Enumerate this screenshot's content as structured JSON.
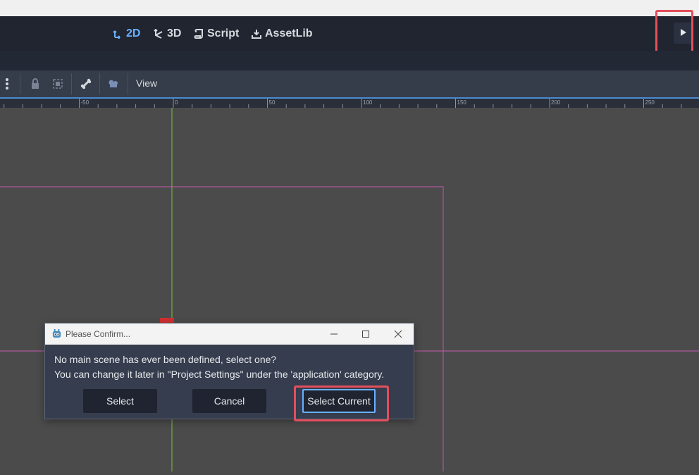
{
  "workspace_tabs": [
    {
      "label": "2D",
      "icon": "2d-icon",
      "active": true
    },
    {
      "label": "3D",
      "icon": "3d-icon",
      "active": false
    },
    {
      "label": "Script",
      "icon": "script-icon",
      "active": false
    },
    {
      "label": "AssetLib",
      "icon": "assetlib-icon",
      "active": false
    }
  ],
  "toolbar": {
    "view_label": "View"
  },
  "ruler": {
    "labels": [
      "-50",
      "0",
      "50",
      "100",
      "150",
      "200",
      "250"
    ]
  },
  "dialog": {
    "title": "Please Confirm...",
    "message_line1": "No main scene has ever been defined, select one?",
    "message_line2": "You can change it later in \"Project Settings\" under the 'application' category.",
    "buttons": {
      "select": "Select",
      "cancel": "Cancel",
      "select_current": "Select Current"
    }
  },
  "colors": {
    "accent": "#6ab0ff",
    "highlight": "#e34f5c",
    "viewport_bg": "#4b4b4b",
    "scene_rect": "#c45ab0",
    "y_axis": "#7fbf3f",
    "x_axis": "#c45ab0"
  }
}
